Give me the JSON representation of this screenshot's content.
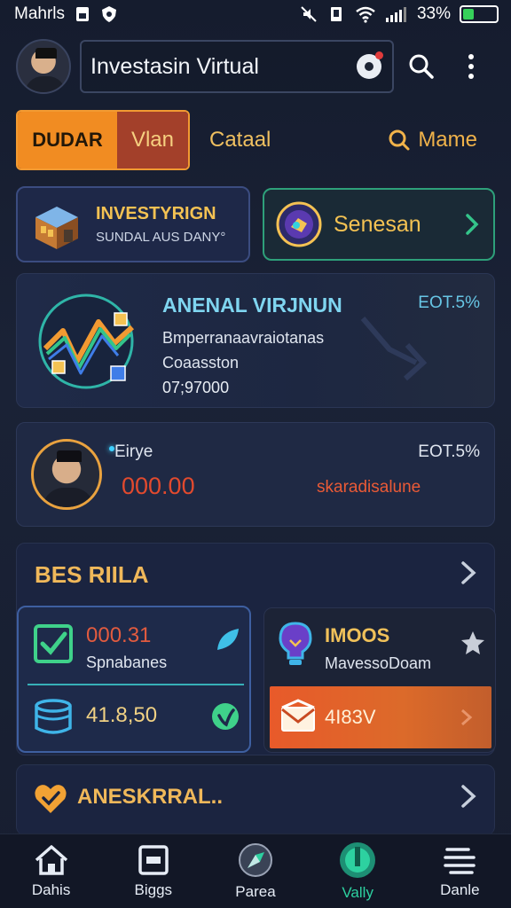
{
  "status_bar": {
    "carrier": "Mahrls",
    "battery_percent": "33%",
    "battery_level": 0.33,
    "icons": [
      "sim-card-icon",
      "shield-icon",
      "mute-icon",
      "vibrate-icon",
      "wifi-icon",
      "signal-icon",
      "battery-icon"
    ]
  },
  "header": {
    "title": "Investasin Virtual",
    "icons": [
      "avatar",
      "record-icon",
      "search-icon",
      "more-vert-icon"
    ]
  },
  "tabs": {
    "active_part1": "DUDAR",
    "active_part2": "Vlan",
    "tab2": "Cataal",
    "search_label": "Mame"
  },
  "quick_actions": {
    "left_title": "INVESTYRIGN",
    "left_subtitle": "SUNDAL AUS DANY°",
    "right_label": "Senesan"
  },
  "feature": {
    "title": "ANENAL VIRJNUN",
    "percent": "EOT.5%",
    "line1": "Bmperranaavraiotanas",
    "line2": "Coaasston",
    "line3": "07;97000"
  },
  "profile": {
    "label": "Eirye",
    "percent": "EOT.5%",
    "amount": "000.00",
    "status": "skaradisalune"
  },
  "section": {
    "title": "BES RIILA",
    "tile_left": {
      "value1": "000.31",
      "subtitle": "Spnabanes",
      "value2": "41.8,50"
    },
    "tile_right": {
      "title": "IMOOS",
      "subtitle": "MavessoDoam",
      "band_text": "4I83V"
    }
  },
  "bottom_card": {
    "title": "ANESKRRAL.."
  },
  "nav": {
    "items": [
      {
        "label": "Dahis",
        "icon": "home-icon"
      },
      {
        "label": "Biggs",
        "icon": "wallet-icon"
      },
      {
        "label": "Parea",
        "icon": "compass-icon"
      },
      {
        "label": "Vally",
        "icon": "chart-icon",
        "active": true
      },
      {
        "label": "Danle",
        "icon": "menu-lines-icon"
      }
    ]
  },
  "colors": {
    "background": "#171e30",
    "accent_orange": "#f18c22",
    "accent_gold": "#f0b85a",
    "accent_teal": "#2dd1a0",
    "alert_red": "#e24a2e"
  }
}
